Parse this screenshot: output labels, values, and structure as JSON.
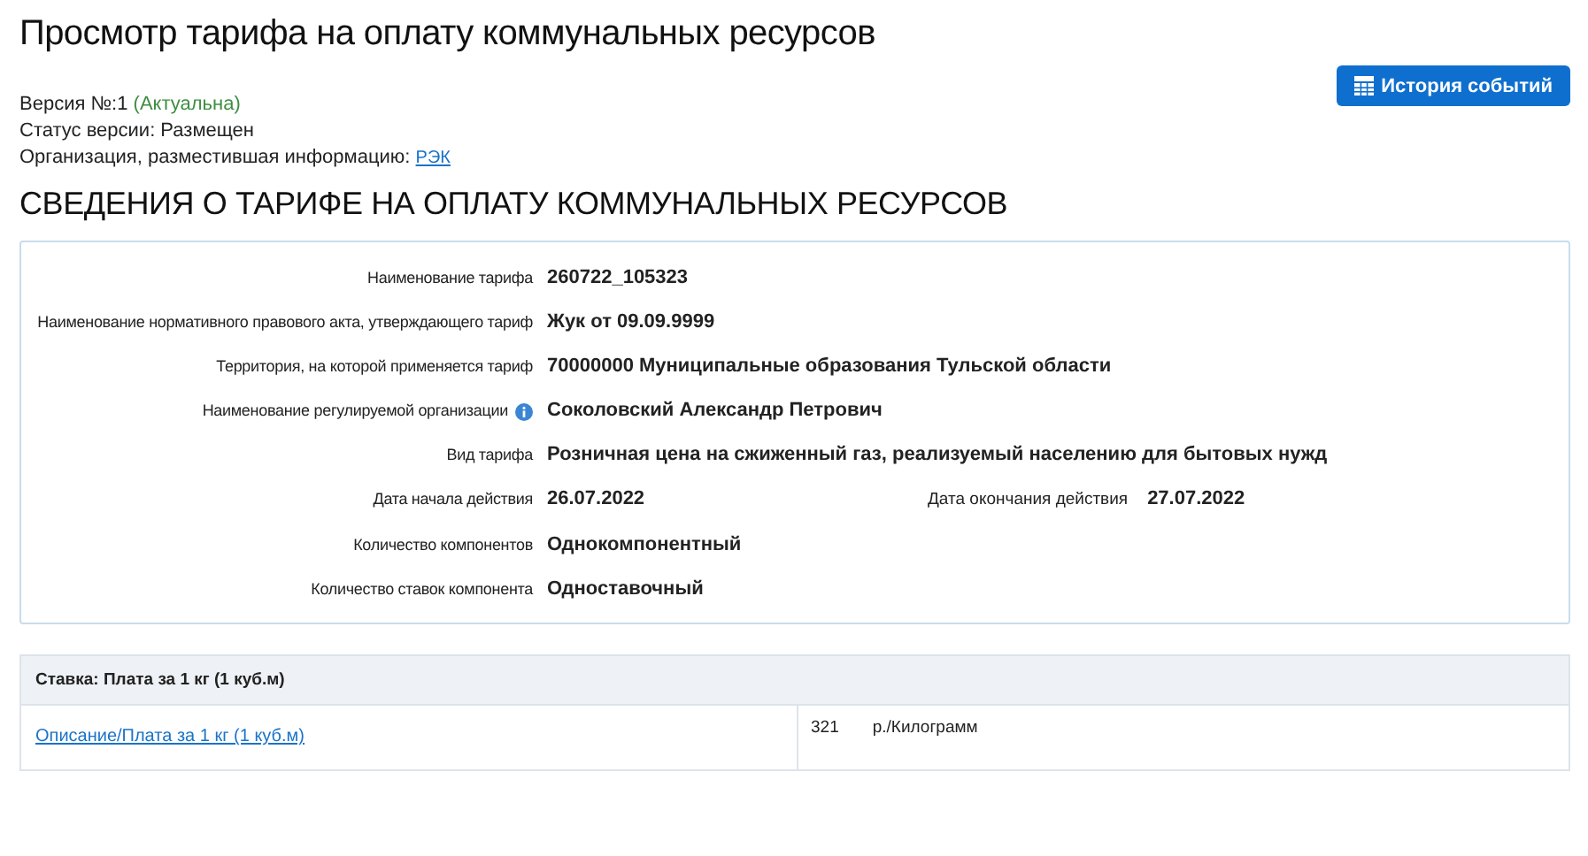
{
  "page_title": "Просмотр тарифа на оплату коммунальных ресурсов",
  "history_button": {
    "label": "История событий"
  },
  "version": {
    "label": "Версия №:1",
    "status": "(Актуальна)"
  },
  "version_status": "Статус версии: Размещен",
  "organization": {
    "label": "Организация, разместившая информацию:",
    "link": "РЭК"
  },
  "section_title": "СВЕДЕНИЯ О ТАРИФЕ НА ОПЛАТУ КОММУНАЛЬНЫХ РЕСУРСОВ",
  "fields": [
    {
      "label": "Наименование тарифа",
      "value": "260722_105323",
      "info": false
    },
    {
      "label": "Наименование нормативного правового акта, утверждающего тариф",
      "value": "Жук от 09.09.9999",
      "info": false
    },
    {
      "label": "Территория, на которой применяется тариф",
      "value": "70000000 Муниципальные образования Тульской области",
      "info": false
    },
    {
      "label": "Наименование регулируемой организации",
      "value": "Соколовский Александр Петрович",
      "info": true
    },
    {
      "label": "Вид тарифа",
      "value": "Розничная цена на сжиженный газ, реализуемый населению для бытовых нужд",
      "info": false
    },
    {
      "label": "Дата начала действия",
      "value": "26.07.2022",
      "info": false,
      "second": {
        "label": "Дата окончания действия",
        "value": "27.07.2022"
      }
    },
    {
      "label": "Количество компонентов",
      "value": "Однокомпонентный",
      "info": false
    },
    {
      "label": "Количество ставок компонента",
      "value": "Одноставочный",
      "info": false
    }
  ],
  "rate": {
    "header": "Ставка: Плата за 1 кг (1 куб.м)",
    "link": "Описание/Плата за 1 кг (1 куб.м)",
    "amount": "321",
    "unit": "р./Килограмм"
  }
}
